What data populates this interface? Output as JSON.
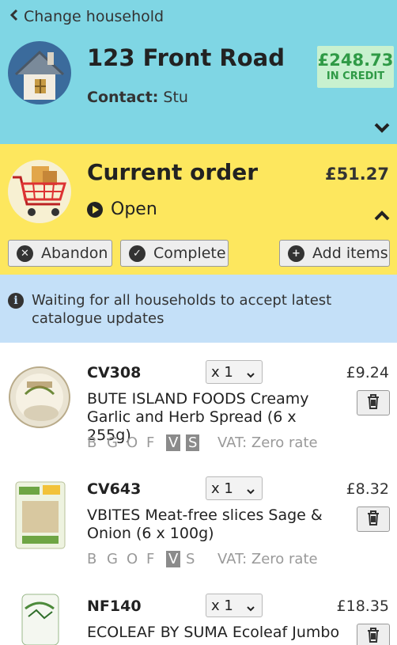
{
  "household": {
    "change_label": "Change household",
    "address": "123 Front Road",
    "contact_label": "Contact:",
    "contact_name": "Stu",
    "credit_amount": "£248.73",
    "credit_label": "IN CREDIT"
  },
  "order": {
    "title": "Current order",
    "total": "£51.27",
    "status": "Open",
    "buttons": {
      "abandon": "Abandon",
      "complete": "Complete",
      "add": "Add items"
    }
  },
  "banner": {
    "text": "Waiting for all households to accept latest catalogue updates"
  },
  "items": [
    {
      "code": "CV308",
      "qty": "x 1",
      "price": "£9.24",
      "description": "BUTE ISLAND FOODS Creamy Garlic and Herb Spread (6 x 255g)",
      "tags": [
        "B",
        "G",
        "O",
        "F",
        "V",
        "S"
      ],
      "tags_active": [
        "V",
        "S"
      ],
      "vat": "VAT: Zero rate"
    },
    {
      "code": "CV643",
      "qty": "x 1",
      "price": "£8.32",
      "description": "VBITES Meat-free slices Sage & Onion (6 x 100g)",
      "tags": [
        "B",
        "G",
        "O",
        "F",
        "V",
        "S"
      ],
      "tags_active": [
        "V"
      ],
      "vat": "VAT: Zero rate"
    },
    {
      "code": "NF140",
      "qty": "x 1",
      "price": "£18.35",
      "description": "ECOLEAF BY SUMA Ecoleaf Jumbo"
    }
  ],
  "icons": {
    "back": "chevron-left-icon",
    "house": "house-icon",
    "cart": "shopping-cart-icon",
    "expand": "chevron-down-icon",
    "collapse": "chevron-up-icon",
    "status": "play-circle-icon",
    "abandon": "times-circle-icon",
    "complete": "check-circle-icon",
    "add": "plus-circle-icon",
    "info": "info-circle-icon",
    "delete": "trash-icon"
  },
  "colors": {
    "household_bg": "#7fd6e4",
    "order_bg": "#fde75e",
    "banner_bg": "#c4e0f8",
    "credit_bg": "#c8f1cf",
    "credit_text": "#2f9a46"
  }
}
